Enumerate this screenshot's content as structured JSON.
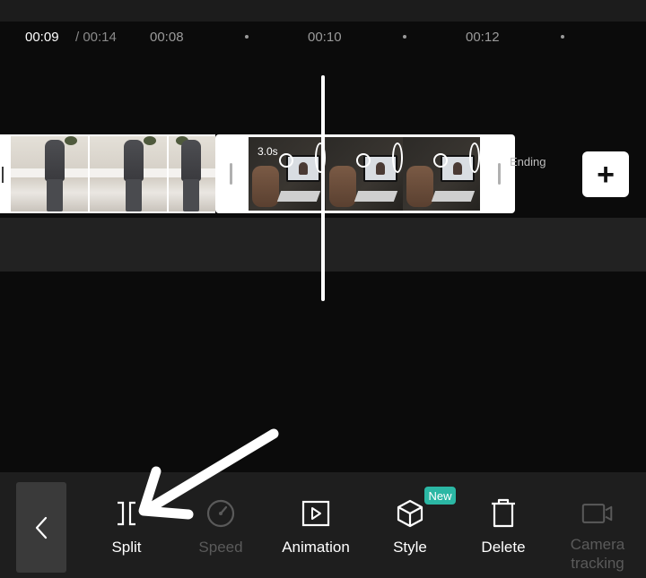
{
  "timeline": {
    "current_time": "00:09",
    "total_time": "/ 00:14",
    "ticks": [
      "00:08",
      "00:10",
      "00:12"
    ]
  },
  "clips": {
    "second_clip_duration": "3.0s",
    "ending_label": "Ending",
    "add_label": "+"
  },
  "toolbar": {
    "items": [
      {
        "label": "Split",
        "enabled": true
      },
      {
        "label": "Speed",
        "enabled": false
      },
      {
        "label": "Animation",
        "enabled": true
      },
      {
        "label": "Style",
        "enabled": true,
        "badge": "New"
      },
      {
        "label": "Delete",
        "enabled": true
      },
      {
        "label": "Camera tracking",
        "enabled": false
      }
    ]
  },
  "icons": {
    "back": "chevron-left-icon",
    "split": "split-icon",
    "speed": "speedometer-icon",
    "animation": "play-square-icon",
    "style": "cube-icon",
    "delete": "trash-icon",
    "camera_tracking": "video-camera-icon",
    "annotation": "arrow-pointer-icon"
  },
  "colors": {
    "background": "#0b0b0b",
    "toolbar_background": "#1e1e1e",
    "badge": "#2bb7a4",
    "disabled_text": "#5a5a5a"
  }
}
